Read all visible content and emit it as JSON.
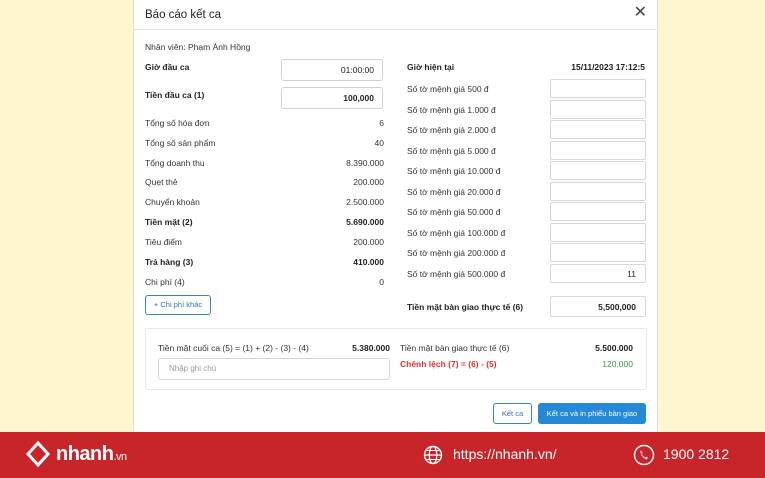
{
  "modal": {
    "title": "Báo cáo kết ca",
    "close_glyph": "✕",
    "staff": "Nhân viên: Phạm Ánh Hồng"
  },
  "left": {
    "start_time_label": "Giờ đầu ca",
    "start_time_value": "01:00:00",
    "start_cash_label": "Tiền đầu ca (1)",
    "start_cash_value": "100,000",
    "rows": [
      {
        "label": "Tổng số hóa đơn",
        "value": "6"
      },
      {
        "label": "Tổng số sản phẩm",
        "value": "40"
      },
      {
        "label": "Tổng doanh thu",
        "value": "8.390.000"
      },
      {
        "label": "Quẹt thẻ",
        "value": "200.000"
      },
      {
        "label": "Chuyển khoản",
        "value": "2.500.000"
      },
      {
        "label": "Tiền mặt (2)",
        "value": "5.690.000"
      },
      {
        "label": "Tiêu điểm",
        "value": "200.000"
      },
      {
        "label": "Trả hàng (3)",
        "value": "410.000"
      },
      {
        "label": "Chi phí (4)",
        "value": "0"
      }
    ],
    "add_expense_label": "+ Chi phí khác"
  },
  "right": {
    "current_time_label": "Giờ hiện tại",
    "current_time_value": "15/11/2023 17:12:5",
    "denominations": [
      {
        "label": "Số tờ mệnh giá 500 đ",
        "value": ""
      },
      {
        "label": "Số tờ mệnh giá 1.000 đ",
        "value": ""
      },
      {
        "label": "Số tờ mệnh giá 2.000 đ",
        "value": ""
      },
      {
        "label": "Số tờ mệnh giá 5.000 đ",
        "value": ""
      },
      {
        "label": "Số tờ mệnh giá 10.000 đ",
        "value": ""
      },
      {
        "label": "Số tờ mệnh giá 20.000 đ",
        "value": ""
      },
      {
        "label": "Số tờ mệnh giá 50.000 đ",
        "value": ""
      },
      {
        "label": "Số tờ mệnh giá 100.000 đ",
        "value": ""
      },
      {
        "label": "Số tờ mệnh giá 200.000 đ",
        "value": ""
      },
      {
        "label": "Số tờ mệnh giá 500.000 đ",
        "value": "11"
      }
    ],
    "handover_label": "Tiền mặt bàn giao thực tế (6)",
    "handover_value": "5,500,000"
  },
  "summary": {
    "end_cash_label": "Tiền mặt cuối ca (5) = (1) + (2) - (3) - (4)",
    "end_cash_value": "5.380.000",
    "note_placeholder": "Nhập ghi chú",
    "handover_label": "Tiền mặt bàn giao thực tế (6)",
    "handover_value": "5.500.000",
    "diff_label": "Chênh lệch (7) = (6) - (5)",
    "diff_value": "120.000"
  },
  "actions": {
    "end_shift": "Kết ca",
    "end_shift_print": "Kết ca và in phiếu bàn giao"
  },
  "footer": {
    "brand": "nhanh",
    "brand_suffix": ".vn",
    "url": "https://nhanh.vn/",
    "phone": "1900 2812"
  },
  "colors": {
    "accent": "#2489d6",
    "diff_label": "#e0322f",
    "diff_value": "#2e9a3b",
    "footer_bg": "#c8252b",
    "page_bg": "#fdf6cf"
  }
}
